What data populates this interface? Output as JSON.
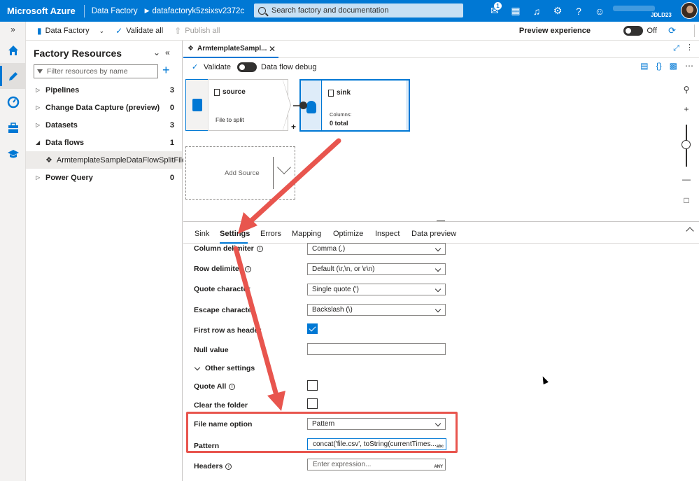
{
  "topbar": {
    "brand": "Microsoft Azure",
    "service": "Data Factory",
    "factory_name": "datafactoryk5zsixsv2372c",
    "search_placeholder": "Search factory and documentation",
    "notification_count": "1",
    "user_initials": "JDLD23"
  },
  "commandbar": {
    "data_factory": "Data Factory",
    "validate_all": "Validate all",
    "publish_all": "Publish all",
    "preview_experience": "Preview experience",
    "preview_state": "Off"
  },
  "resources": {
    "title": "Factory Resources",
    "filter_placeholder": "Filter resources by name",
    "items": [
      {
        "label": "Pipelines",
        "count": "3"
      },
      {
        "label": "Change Data Capture (preview)",
        "count": "0"
      },
      {
        "label": "Datasets",
        "count": "3"
      },
      {
        "label": "Data flows",
        "count": "1"
      },
      {
        "label": "Power Query",
        "count": "0"
      }
    ],
    "dataflow_child": "ArmtemplateSampleDataFlowSplitFile"
  },
  "tab": {
    "label": "ArmtemplateSampl..."
  },
  "toolbar": {
    "validate": "Validate",
    "debug": "Data flow debug"
  },
  "canvas": {
    "source_title": "source",
    "source_sub": "File to split",
    "sink_title": "sink",
    "sink_columns_label": "Columns:",
    "sink_columns_value": "0 total",
    "add_source": "Add Source"
  },
  "panel": {
    "tabs": [
      "Sink",
      "Settings",
      "Errors",
      "Mapping",
      "Optimize",
      "Inspect",
      "Data preview"
    ],
    "fields": {
      "column_delimiter_label": "Column delimiter",
      "column_delimiter_value": "Comma (,)",
      "row_delimiter_label": "Row delimiter",
      "row_delimiter_value": "Default (\\r,\\n, or \\r\\n)",
      "quote_character_label": "Quote character",
      "quote_character_value": "Single quote (')",
      "escape_character_label": "Escape character",
      "escape_character_value": "Backslash (\\)",
      "first_row_header_label": "First row as header",
      "null_value_label": "Null value",
      "other_settings_label": "Other settings",
      "quote_all_label": "Quote All",
      "clear_folder_label": "Clear the folder",
      "file_name_option_label": "File name option",
      "file_name_option_value": "Pattern",
      "pattern_label": "Pattern",
      "pattern_value": "concat('file.csv', toString(currentTimes...",
      "pattern_tag": "abc",
      "headers_label": "Headers",
      "headers_placeholder": "Enter expression...",
      "headers_tag": "ANY"
    }
  },
  "colors": {
    "azure_blue": "#0078d4",
    "annotation_red": "#e8554e"
  }
}
